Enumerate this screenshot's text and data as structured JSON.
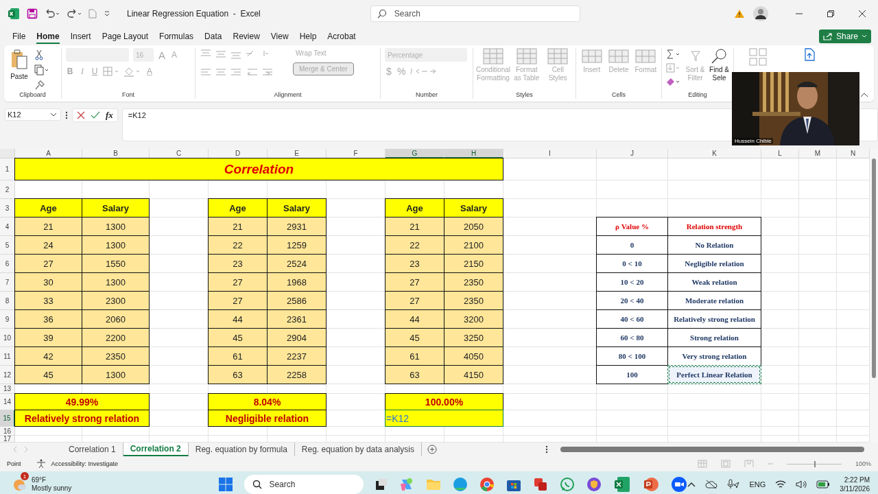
{
  "window": {
    "title": "Linear Regression Equation  -  Excel",
    "search": {
      "placeholder": "Search"
    }
  },
  "menu_tabs": [
    {
      "label": "File",
      "selected": false
    },
    {
      "label": "Home",
      "selected": true
    },
    {
      "label": "Insert",
      "selected": false
    },
    {
      "label": "Page Layout",
      "selected": false
    },
    {
      "label": "Formulas",
      "selected": false
    },
    {
      "label": "Data",
      "selected": false
    },
    {
      "label": "Review",
      "selected": false
    },
    {
      "label": "View",
      "selected": false
    },
    {
      "label": "Help",
      "selected": false
    },
    {
      "label": "Acrobat",
      "selected": false
    }
  ],
  "share_button": "Share",
  "ribbon": {
    "clipboard": {
      "paste": "Paste",
      "label": "Clipboard",
      "disabled": false
    },
    "font": {
      "size": "16",
      "size_buttons": [
        "A",
        "A"
      ],
      "buttons": [
        "B",
        "I",
        "U"
      ],
      "color_letter": "A",
      "label": "Font",
      "disabled": true
    },
    "alignment": {
      "wrap": "Wrap Text",
      "merge": "Merge & Center",
      "label": "Alignment",
      "disabled": true
    },
    "number": {
      "format": "Percentage",
      "symbols": [
        "$",
        "%"
      ],
      "label": "Number",
      "disabled": true
    },
    "styles": {
      "buttons": [
        "Conditional Formatting",
        "Format as Table",
        "Cell Styles"
      ],
      "label": "Styles",
      "disabled": true
    },
    "cells": {
      "buttons": [
        "Insert",
        "Delete",
        "Format"
      ],
      "label": "Cells",
      "disabled": true
    },
    "editing": {
      "buttons": [
        {
          "label": "Sort & Filter",
          "disabled": true
        },
        {
          "label": "Find & Sele",
          "disabled": false
        }
      ],
      "label": "Editing"
    }
  },
  "video": {
    "label": "Hussein Chible"
  },
  "formula_bar": {
    "name_box": "K12",
    "fx": "fx",
    "formula": "=K12"
  },
  "sheet": {
    "columns": [
      {
        "letter": "A",
        "selected": false
      },
      {
        "letter": "B",
        "selected": false
      },
      {
        "letter": "C",
        "selected": false
      },
      {
        "letter": "D",
        "selected": false
      },
      {
        "letter": "E",
        "selected": false
      },
      {
        "letter": "F",
        "selected": false
      },
      {
        "letter": "G",
        "selected": true
      },
      {
        "letter": "H",
        "selected": true
      },
      {
        "letter": "I",
        "selected": false
      },
      {
        "letter": "J",
        "selected": false
      },
      {
        "letter": "K",
        "selected": false
      },
      {
        "letter": "L",
        "selected": false
      },
      {
        "letter": "M",
        "selected": false
      },
      {
        "letter": "N",
        "selected": false
      }
    ],
    "rows": [
      {
        "number": "1",
        "selected": false
      },
      {
        "number": "2",
        "selected": false
      },
      {
        "number": "3",
        "selected": false
      },
      {
        "number": "4",
        "selected": false
      },
      {
        "number": "5",
        "selected": false
      },
      {
        "number": "6",
        "selected": false
      },
      {
        "number": "7",
        "selected": false
      },
      {
        "number": "8",
        "selected": false
      },
      {
        "number": "9",
        "selected": false
      },
      {
        "number": "10",
        "selected": false
      },
      {
        "number": "11",
        "selected": false
      },
      {
        "number": "12",
        "selected": false
      },
      {
        "number": "13",
        "selected": false
      },
      {
        "number": "14",
        "selected": false
      },
      {
        "number": "15",
        "selected": true
      },
      {
        "number": "16",
        "selected": false
      },
      {
        "number": "17",
        "selected": false
      }
    ],
    "title": "Correlation",
    "blocks": [
      {
        "headers": [
          "Age",
          "Salary"
        ],
        "rows": [
          [
            "21",
            "1300"
          ],
          [
            "24",
            "1300"
          ],
          [
            "27",
            "1550"
          ],
          [
            "30",
            "1300"
          ],
          [
            "33",
            "2300"
          ],
          [
            "36",
            "2060"
          ],
          [
            "39",
            "2200"
          ],
          [
            "42",
            "2350"
          ],
          [
            "45",
            "1300"
          ]
        ],
        "result": "49.99%",
        "verdict": {
          "text": "Relatively strong relation",
          "editing": false
        }
      },
      {
        "headers": [
          "Age",
          "Salary"
        ],
        "rows": [
          [
            "21",
            "2931"
          ],
          [
            "22",
            "1259"
          ],
          [
            "23",
            "2524"
          ],
          [
            "27",
            "1968"
          ],
          [
            "27",
            "2586"
          ],
          [
            "44",
            "2361"
          ],
          [
            "45",
            "2904"
          ],
          [
            "61",
            "2237"
          ],
          [
            "63",
            "2258"
          ]
        ],
        "result": "8.04%",
        "verdict": {
          "text": "Negligible relation",
          "editing": false
        }
      },
      {
        "headers": [
          "Age",
          "Salary"
        ],
        "rows": [
          [
            "21",
            "2050"
          ],
          [
            "22",
            "2100"
          ],
          [
            "23",
            "2150"
          ],
          [
            "27",
            "2350"
          ],
          [
            "27",
            "2350"
          ],
          [
            "44",
            "3200"
          ],
          [
            "45",
            "3250"
          ],
          [
            "61",
            "4050"
          ],
          [
            "63",
            "4150"
          ]
        ],
        "result": "100.00%",
        "verdict": {
          "text": "=K12",
          "editing": true
        }
      }
    ],
    "reference": {
      "headers": [
        "ρ Value %",
        "Relation strength"
      ],
      "rows": [
        {
          "value": "0",
          "label": "No Relation",
          "marquee": false
        },
        {
          "value": "0 < 10",
          "label": "Negligible relation",
          "marquee": false
        },
        {
          "value": "10 < 20",
          "label": "Weak relation",
          "marquee": false
        },
        {
          "value": "20 < 40",
          "label": "Moderate relation",
          "marquee": false
        },
        {
          "value": "40 < 60",
          "label": "Relatively strong relation",
          "marquee": false
        },
        {
          "value": "60 < 80",
          "label": "Strong relation",
          "marquee": false
        },
        {
          "value": "80 < 100",
          "label": "Very strong relation",
          "marquee": false
        },
        {
          "value": "100",
          "label": "Perfect Linear Relation",
          "marquee": true
        }
      ]
    }
  },
  "sheet_tabs": [
    {
      "label": "Correlation 1",
      "selected": false
    },
    {
      "label": "Correlation 2",
      "selected": true
    },
    {
      "label": "Reg. equation by formula",
      "selected": false
    },
    {
      "label": "Reg. equation by data analysis",
      "selected": false
    }
  ],
  "status_bar": {
    "mode": "Point",
    "accessibility": "Accessibility: Investigate",
    "zoom": "100%",
    "zoom_slider": {
      "level": 0.5
    }
  },
  "taskbar": {
    "weather": {
      "badge": "1",
      "temperature": "69°F",
      "condition": "Mostly sunny"
    },
    "search": {
      "placeholder": "Search"
    },
    "language": "ENG",
    "time": "2:22 PM",
    "date": "3/11/2026"
  }
}
